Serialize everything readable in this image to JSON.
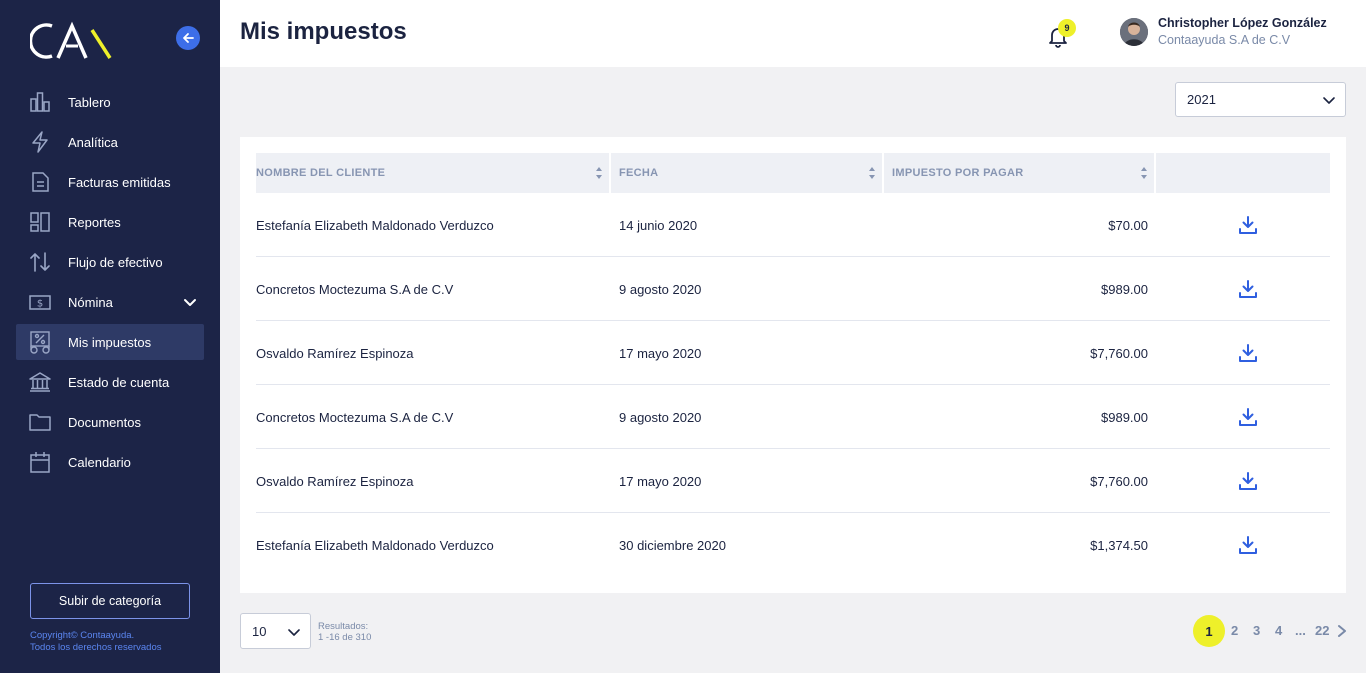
{
  "colors": {
    "sidebar_bg": "#1c2447",
    "accent_blue": "#3d6ee8",
    "accent_yellow": "#eef02a",
    "text_dark": "#1b2340",
    "text_muted": "#7a8aa8"
  },
  "sidebar": {
    "logo_alt": "CA",
    "items": [
      {
        "label": "Tablero",
        "icon": "bar-chart-icon"
      },
      {
        "label": "Analítica",
        "icon": "lightning-icon"
      },
      {
        "label": "Facturas emitidas",
        "icon": "document-icon"
      },
      {
        "label": "Reportes",
        "icon": "reports-icon"
      },
      {
        "label": "Flujo de efectivo",
        "icon": "arrows-updown-icon"
      },
      {
        "label": "Nómina",
        "icon": "dollar-bill-icon"
      },
      {
        "label": "Mis impuestos",
        "icon": "tax-icon"
      },
      {
        "label": "Estado de cuenta",
        "icon": "bank-icon"
      },
      {
        "label": "Documentos",
        "icon": "folder-icon"
      },
      {
        "label": "Calendario",
        "icon": "calendar-icon"
      }
    ],
    "upgrade_label": "Subir de categoría",
    "copyright_line1": "Copyright© Contaayuda.",
    "copyright_line2": "Todos los derechos reservados"
  },
  "header": {
    "title": "Mis impuestos",
    "notification_count": "9",
    "user_name": "Christopher López González",
    "user_company": "Contaayuda S.A de C.V"
  },
  "filters": {
    "year": "2021"
  },
  "table": {
    "columns": [
      "NOMBRE DEL CLIENTE",
      "FECHA",
      "IMPUESTO POR PAGAR",
      ""
    ],
    "rows": [
      {
        "name": "Estefanía Elizabeth Maldonado Verduzco",
        "date": "14 junio 2020",
        "amount": "$70.00"
      },
      {
        "name": "Concretos Moctezuma S.A de C.V",
        "date": "9 agosto 2020",
        "amount": "$989.00"
      },
      {
        "name": "Osvaldo Ramírez Espinoza",
        "date": "17 mayo 2020",
        "amount": "$7,760.00"
      },
      {
        "name": "Concretos Moctezuma S.A de C.V",
        "date": "9 agosto 2020",
        "amount": "$989.00"
      },
      {
        "name": "Osvaldo Ramírez Espinoza",
        "date": "17 mayo 2020",
        "amount": "$7,760.00"
      },
      {
        "name": "Estefanía Elizabeth Maldonado Verduzco",
        "date": "30 diciembre 2020",
        "amount": "$1,374.50"
      }
    ]
  },
  "pagination": {
    "per_page": "10",
    "results_label": "Resultados:",
    "results_range": "1 -16 de 310",
    "pages": [
      "1",
      "2",
      "3",
      "4",
      "...",
      "22"
    ],
    "current": "1"
  }
}
